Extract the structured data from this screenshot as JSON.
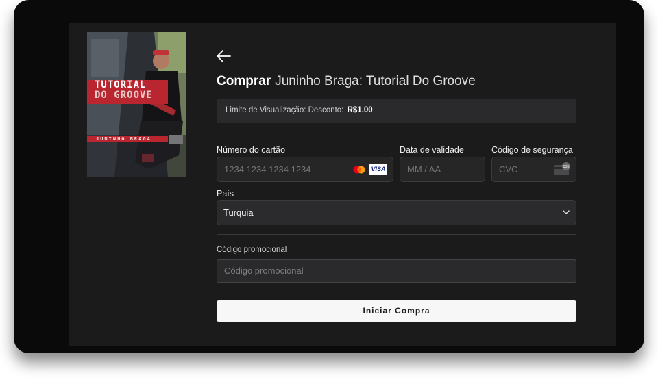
{
  "poster": {
    "title_line1": "TUTORIAL",
    "title_line2": "DO GROOVE",
    "artist": "JUNINHO BRAGA"
  },
  "header": {
    "back_icon": "arrow-left-icon",
    "buy_label": "Comprar",
    "product_title": "Juninho Braga: Tutorial Do Groove"
  },
  "limit": {
    "text": "Limite de Visualização: Desconto:",
    "price": "R$1.00"
  },
  "card": {
    "number_label": "Número do cartão",
    "number_placeholder": "1234 1234 1234 1234",
    "brand_icons": [
      "mastercard-icon",
      "visa-icon"
    ],
    "visa_text": "VISA",
    "expiry_label": "Data de validade",
    "expiry_placeholder": "MM / AA",
    "cvc_label": "Código de segurança",
    "cvc_placeholder": "CVC",
    "cvc_icon": "card-cvc-icon",
    "cvc_icon_digits": "135"
  },
  "country": {
    "label": "País",
    "value": "Turquia",
    "icon": "chevron-down-icon"
  },
  "promo": {
    "label": "Código promocional",
    "placeholder": "Código promocional"
  },
  "actions": {
    "submit_label": "Iniciar Compra"
  },
  "colors": {
    "background": "#1b1b1c",
    "frame": "#0a0a0a",
    "field": "#262627",
    "button": "#f7f7f7",
    "poster_accent": "#b9262f"
  }
}
